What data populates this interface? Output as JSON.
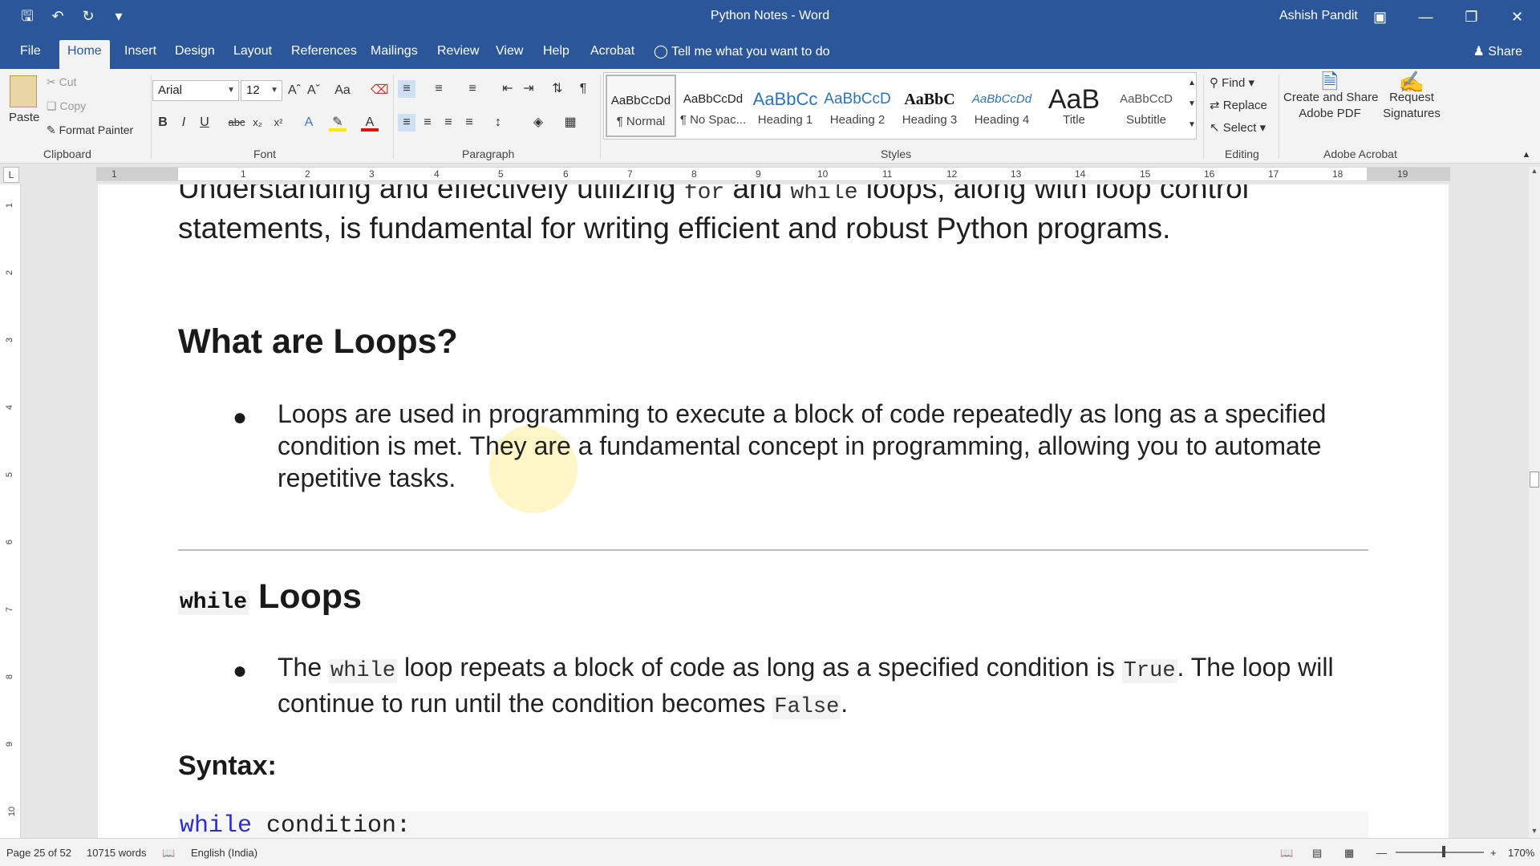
{
  "window": {
    "title": "Python Notes  -  Word",
    "user": "Ashish Pandit",
    "share": "Share"
  },
  "qat": {
    "save_icon": "save-icon",
    "undo_icon": "undo-icon",
    "redo_icon": "redo-icon",
    "customize_icon": "customize-icon"
  },
  "tabs": [
    {
      "label": "File"
    },
    {
      "label": "Home"
    },
    {
      "label": "Insert"
    },
    {
      "label": "Design"
    },
    {
      "label": "Layout"
    },
    {
      "label": "References"
    },
    {
      "label": "Mailings"
    },
    {
      "label": "Review"
    },
    {
      "label": "View"
    },
    {
      "label": "Help"
    },
    {
      "label": "Acrobat"
    }
  ],
  "tell_me": "Tell me what you want to do",
  "ribbon": {
    "clipboard": {
      "label": "Clipboard",
      "paste": "Paste",
      "cut": "Cut",
      "copy": "Copy",
      "format_painter": "Format Painter"
    },
    "font": {
      "label": "Font",
      "name": "Arial",
      "size": "12"
    },
    "paragraph": {
      "label": "Paragraph"
    },
    "styles": {
      "label": "Styles",
      "items": [
        {
          "preview": "AaBbCcDd",
          "name": "¶ Normal"
        },
        {
          "preview": "AaBbCcDd",
          "name": "¶ No Spac..."
        },
        {
          "preview": "AaBbCc",
          "name": "Heading 1"
        },
        {
          "preview": "AaBbCcD",
          "name": "Heading 2"
        },
        {
          "preview": "AaBbC",
          "name": "Heading 3"
        },
        {
          "preview": "AaBbCcDd",
          "name": "Heading 4"
        },
        {
          "preview": "AaB",
          "name": "Title"
        },
        {
          "preview": "AaBbCcD",
          "name": "Subtitle"
        }
      ]
    },
    "editing": {
      "label": "Editing",
      "find": "Find",
      "replace": "Replace",
      "select": "Select"
    },
    "acrobat": {
      "label": "Adobe Acrobat",
      "create_line1": "Create and Share",
      "create_line2": "Adobe PDF",
      "request_line1": "Request",
      "request_line2": "Signatures"
    }
  },
  "ruler": {
    "numbers": [
      "1",
      "1",
      "2",
      "3",
      "4",
      "5",
      "6",
      "7",
      "8",
      "9",
      "10",
      "11",
      "12",
      "13",
      "14",
      "15",
      "16",
      "17",
      "18",
      "19"
    ],
    "vnumbers": [
      "1",
      "2",
      "3",
      "4",
      "5",
      "6",
      "7",
      "8",
      "9",
      "10"
    ]
  },
  "document": {
    "intro_line1_a": "Understanding and effectively utilizing ",
    "intro_for": "for",
    "intro_and": " and ",
    "intro_while": "while",
    "intro_line1_b": " loops, along with loop control",
    "intro_line2": "statements, is fundamental for writing efficient and robust Python programs.",
    "heading_loops": "What are Loops?",
    "loops_para": "Loops are used in programming to execute a block of code repeatedly as long as a specified condition is met. They are a fundamental concept in programming, allowing you to automate repetitive tasks.",
    "heading_while_code": "while",
    "heading_while_text": " Loops",
    "while_p_a": "The ",
    "while_p_code1": "while",
    "while_p_b": " loop repeats a block of code as long as a specified condition is ",
    "while_p_code2": "True",
    "while_p_c": ". The loop will continue to run until the condition becomes ",
    "while_p_code3": "False",
    "while_p_d": ".",
    "heading_syntax": "Syntax:",
    "code_kw": "while",
    "code_rest": " condition:"
  },
  "status": {
    "page": "Page 25 of 52",
    "words": "10715 words",
    "language": "English (India)",
    "zoom": "170%"
  }
}
